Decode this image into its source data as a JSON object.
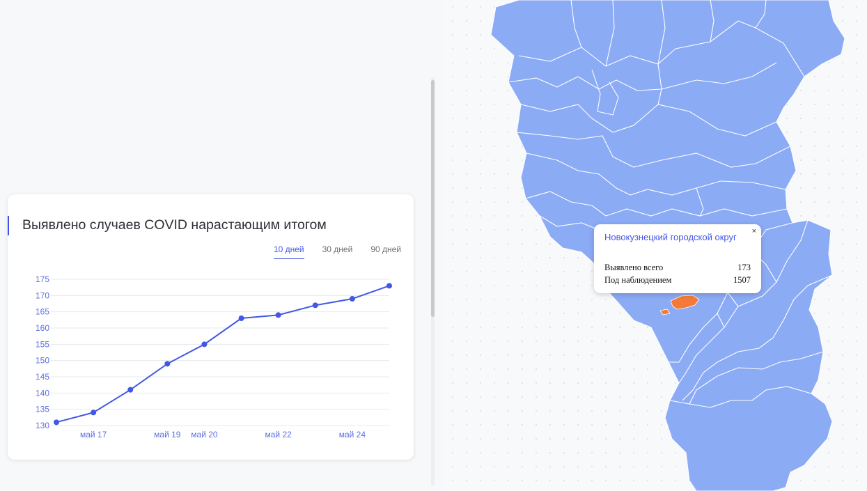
{
  "chart_panel": {
    "title": "Выявлено случаев COVID нарастающим итогом",
    "range_tabs": [
      {
        "label": "10 дней",
        "active": true
      },
      {
        "label": "30 дней",
        "active": false
      },
      {
        "label": "90 дней",
        "active": false
      }
    ]
  },
  "chart_data": {
    "type": "line",
    "title": "Выявлено случаев COVID нарастающим итогом",
    "x": [
      "2020-05-16",
      "2020-05-17",
      "2020-05-18",
      "2020-05-19",
      "2020-05-20",
      "2020-05-21",
      "2020-05-22",
      "2020-05-23",
      "2020-05-24",
      "2020-05-25"
    ],
    "series": [
      {
        "values": [
          131,
          134,
          141,
          149,
          155,
          163,
          164,
          167,
          169,
          173
        ]
      }
    ],
    "x_tick_labels": [
      "май 17",
      "май 19",
      "май 20",
      "май 22",
      "май 24"
    ],
    "y_ticks": [
      130,
      135,
      140,
      145,
      150,
      155,
      160,
      165,
      170,
      175
    ],
    "ylim": [
      130,
      175
    ],
    "grid": true,
    "line_color": "#4257e6"
  },
  "map": {
    "region_color": "#8cabf5",
    "highlight_color": "#f47a3a",
    "tooltip": {
      "title": "Новокузнецкий городской округ",
      "close": "×",
      "rows": [
        {
          "label": "Выявлено всего",
          "value": "173"
        },
        {
          "label": "Под наблюдением",
          "value": "1507"
        }
      ]
    }
  }
}
